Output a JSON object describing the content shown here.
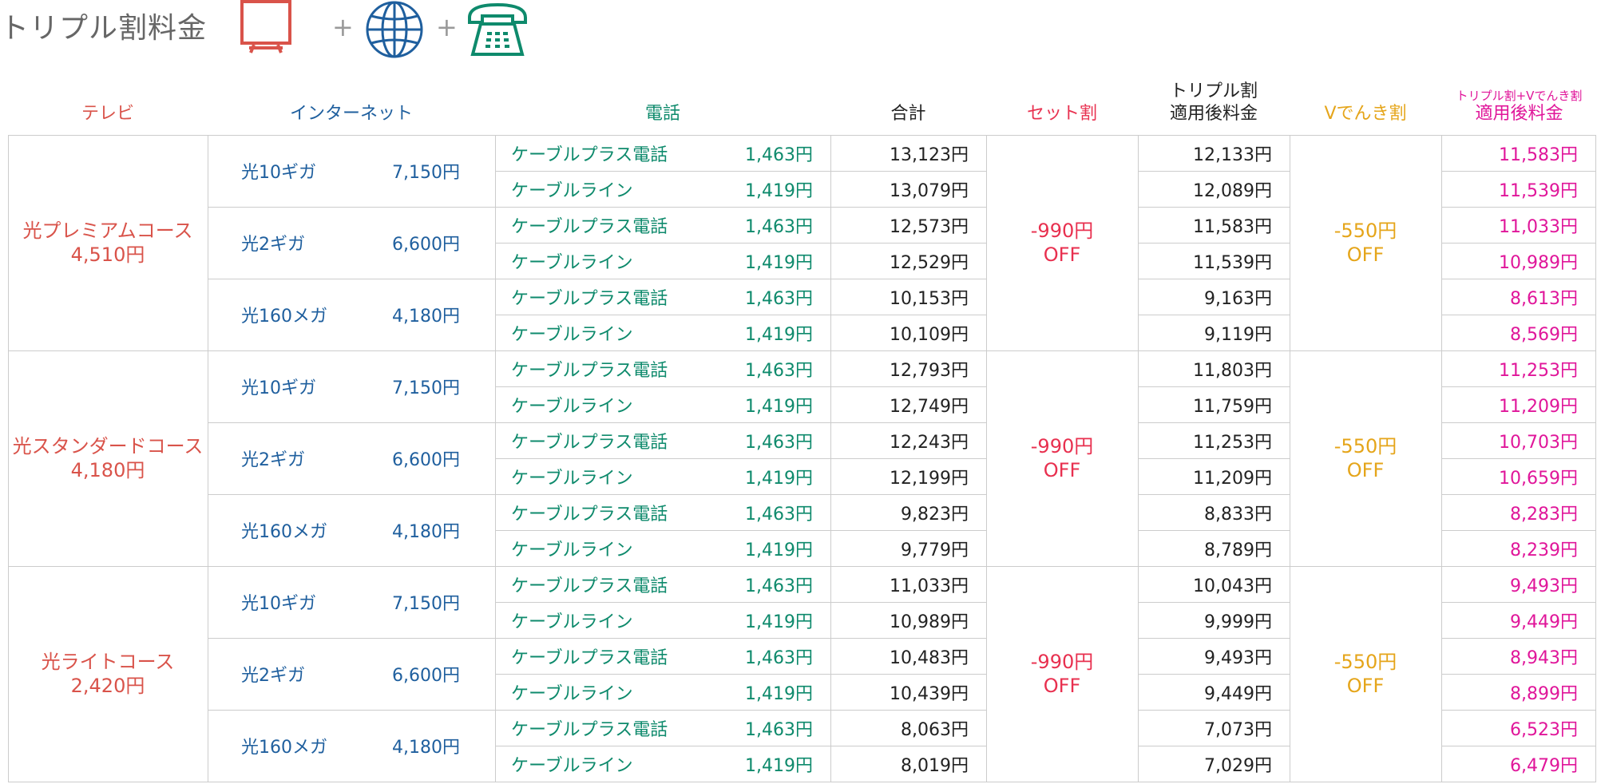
{
  "title": "トリプル割料金",
  "icons": [
    "tv-icon",
    "globe-icon",
    "telephone-icon"
  ],
  "plus_sign": "+",
  "colors": {
    "tv": "#d9534a",
    "internet": "#1f5f9e",
    "phone": "#0e8a6c",
    "set_discount": "#e8304f",
    "v_denki": "#e5a51a",
    "final": "#e0169a",
    "grid": "#cccccc"
  },
  "headers": {
    "tv": "テレビ",
    "internet": "インターネット",
    "phone": "電話",
    "total": "合計",
    "set_discount": "セット割",
    "triple_line1": "トリプル割",
    "triple_line2": "適用後料金",
    "v_denki": "Vでんき割",
    "final_line1": "トリプル割+Vでんき割",
    "final_line2": "適用後料金"
  },
  "discounts": {
    "set_amount": "-990円",
    "set_off": "OFF",
    "v_amount": "-550円",
    "v_off": "OFF"
  },
  "courses": [
    {
      "name": "光プレミアムコース",
      "price": "4,510円",
      "plans": [
        {
          "name": "光10ギガ",
          "price": "7,150円",
          "rows": [
            {
              "phone": "ケーブルプラス電話",
              "phone_price": "1,463円",
              "total": "13,123円",
              "triple": "12,133円",
              "final": "11,583円"
            },
            {
              "phone": "ケーブルライン",
              "phone_price": "1,419円",
              "total": "13,079円",
              "triple": "12,089円",
              "final": "11,539円"
            }
          ]
        },
        {
          "name": "光2ギガ",
          "price": "6,600円",
          "rows": [
            {
              "phone": "ケーブルプラス電話",
              "phone_price": "1,463円",
              "total": "12,573円",
              "triple": "11,583円",
              "final": "11,033円"
            },
            {
              "phone": "ケーブルライン",
              "phone_price": "1,419円",
              "total": "12,529円",
              "triple": "11,539円",
              "final": "10,989円"
            }
          ]
        },
        {
          "name": "光160メガ",
          "price": "4,180円",
          "rows": [
            {
              "phone": "ケーブルプラス電話",
              "phone_price": "1,463円",
              "total": "10,153円",
              "triple": "9,163円",
              "final": "8,613円"
            },
            {
              "phone": "ケーブルライン",
              "phone_price": "1,419円",
              "total": "10,109円",
              "triple": "9,119円",
              "final": "8,569円"
            }
          ]
        }
      ]
    },
    {
      "name": "光スタンダードコース",
      "price": "4,180円",
      "plans": [
        {
          "name": "光10ギガ",
          "price": "7,150円",
          "rows": [
            {
              "phone": "ケーブルプラス電話",
              "phone_price": "1,463円",
              "total": "12,793円",
              "triple": "11,803円",
              "final": "11,253円"
            },
            {
              "phone": "ケーブルライン",
              "phone_price": "1,419円",
              "total": "12,749円",
              "triple": "11,759円",
              "final": "11,209円"
            }
          ]
        },
        {
          "name": "光2ギガ",
          "price": "6,600円",
          "rows": [
            {
              "phone": "ケーブルプラス電話",
              "phone_price": "1,463円",
              "total": "12,243円",
              "triple": "11,253円",
              "final": "10,703円"
            },
            {
              "phone": "ケーブルライン",
              "phone_price": "1,419円",
              "total": "12,199円",
              "triple": "11,209円",
              "final": "10,659円"
            }
          ]
        },
        {
          "name": "光160メガ",
          "price": "4,180円",
          "rows": [
            {
              "phone": "ケーブルプラス電話",
              "phone_price": "1,463円",
              "total": "9,823円",
              "triple": "8,833円",
              "final": "8,283円"
            },
            {
              "phone": "ケーブルライン",
              "phone_price": "1,419円",
              "total": "9,779円",
              "triple": "8,789円",
              "final": "8,239円"
            }
          ]
        }
      ]
    },
    {
      "name": "光ライトコース",
      "price": "2,420円",
      "plans": [
        {
          "name": "光10ギガ",
          "price": "7,150円",
          "rows": [
            {
              "phone": "ケーブルプラス電話",
              "phone_price": "1,463円",
              "total": "11,033円",
              "triple": "10,043円",
              "final": "9,493円"
            },
            {
              "phone": "ケーブルライン",
              "phone_price": "1,419円",
              "total": "10,989円",
              "triple": "9,999円",
              "final": "9,449円"
            }
          ]
        },
        {
          "name": "光2ギガ",
          "price": "6,600円",
          "rows": [
            {
              "phone": "ケーブルプラス電話",
              "phone_price": "1,463円",
              "total": "10,483円",
              "triple": "9,493円",
              "final": "8,943円"
            },
            {
              "phone": "ケーブルライン",
              "phone_price": "1,419円",
              "total": "10,439円",
              "triple": "9,449円",
              "final": "8,899円"
            }
          ]
        },
        {
          "name": "光160メガ",
          "price": "4,180円",
          "rows": [
            {
              "phone": "ケーブルプラス電話",
              "phone_price": "1,463円",
              "total": "8,063円",
              "triple": "7,073円",
              "final": "6,523円"
            },
            {
              "phone": "ケーブルライン",
              "phone_price": "1,419円",
              "total": "8,019円",
              "triple": "7,029円",
              "final": "6,479円"
            }
          ]
        }
      ]
    }
  ]
}
